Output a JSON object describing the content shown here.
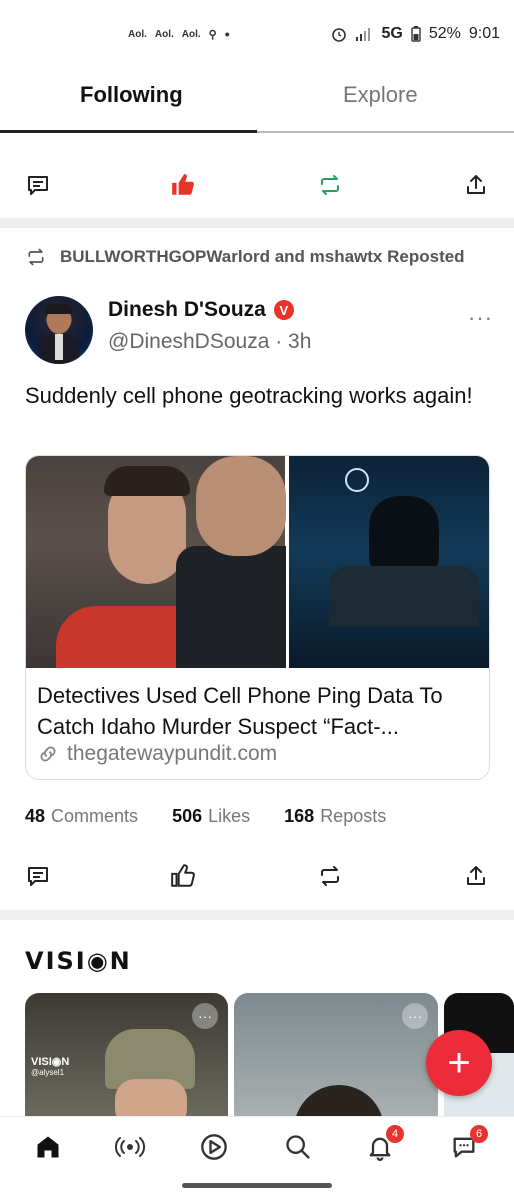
{
  "status_bar": {
    "left_items": [
      "Aol.",
      "Aol.",
      "Aol."
    ],
    "network": "5G",
    "battery": "52%",
    "time": "9:01"
  },
  "tabs": [
    {
      "label": "Following",
      "active": true
    },
    {
      "label": "Explore",
      "active": false
    }
  ],
  "post": {
    "repost_text": "BULLWORTHGOPWarlord and mshawtx Reposted",
    "author_name": "Dinesh D'Souza",
    "verified_mark": "V",
    "handle": "@DineshDSouza · 3h",
    "more": "···",
    "text": "Suddenly cell phone geotracking works again!",
    "card_title": "Detectives Used Cell Phone Ping Data To Catch Idaho Murder Suspect “Fact-...",
    "card_link": "thegatewaypundit.com",
    "stats": [
      {
        "count": "48",
        "label": "Comments"
      },
      {
        "count": "506",
        "label": "Likes"
      },
      {
        "count": "168",
        "label": "Reposts"
      }
    ]
  },
  "vision": {
    "logo": "VISI◉N",
    "card_more": "···",
    "card1_label": "VISI◉N",
    "card1_user": "@alysel1"
  },
  "nav_badges": {
    "notifications": "4",
    "messages": "6"
  },
  "colors": {
    "accent": "#ec2c3a",
    "like_active": "#e8342c",
    "repost_active": "#1fa65a"
  }
}
